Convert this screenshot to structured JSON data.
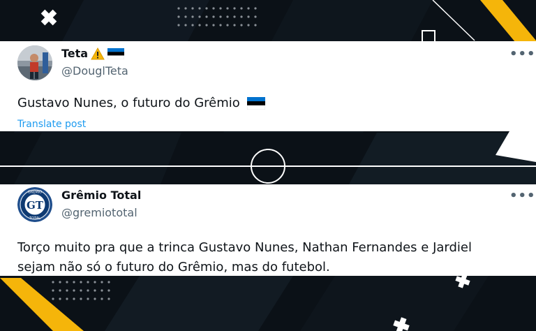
{
  "tweets": [
    {
      "display_name": "Teta",
      "name_badges": [
        "warning-icon",
        "estonia-flag-icon"
      ],
      "handle": "@DouglTeta",
      "more_label": "•••",
      "text": "Gustavo Nunes, o futuro do Grêmio",
      "text_emoji": "estonia-flag-icon",
      "translate_label": "Translate post"
    },
    {
      "display_name": "Grêmio Total",
      "handle": "@gremiototal",
      "more_label": "•••",
      "avatar_monogram": "GT",
      "avatar_ring_text_top": "GRÊMIO",
      "avatar_ring_text_bottom": "TOTAL",
      "text_lines": [
        "Torço muito pra que a trinca Gustavo Nunes, Nathan Fernandes e Jardiel",
        "sejam não só o futuro do Grêmio, mas do futebol."
      ]
    }
  ],
  "colors": {
    "background": "#0b1117",
    "accent_yellow": "#f5b50a",
    "link_blue": "#1d9bf0",
    "estonia_blue": "#0072ce"
  }
}
